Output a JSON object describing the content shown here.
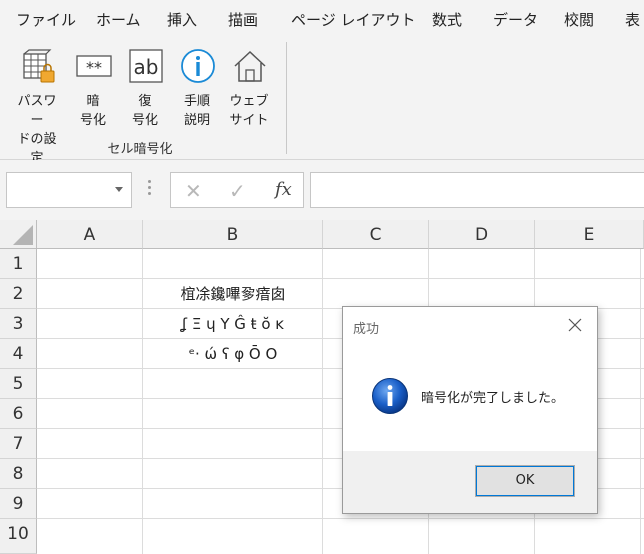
{
  "menu": {
    "tabs": [
      "ファイル",
      "ホーム",
      "挿入",
      "描画",
      "ページ レイアウト",
      "数式",
      "データ",
      "校閲",
      "表"
    ]
  },
  "ribbon": {
    "buttons": [
      {
        "label": "パスワー\nドの設定",
        "icon": "lock-grid-icon"
      },
      {
        "label": "暗\n号化",
        "icon": "asterisk-box-icon"
      },
      {
        "label": "復\n号化",
        "icon": "ab-box-icon"
      },
      {
        "label": "手順\n説明",
        "icon": "info-circle-icon"
      },
      {
        "label": "ウェブ\nサイト",
        "icon": "house-icon"
      }
    ],
    "group_label": "セル暗号化"
  },
  "formula_bar": {
    "name_box_value": "",
    "cancel_glyph": "✕",
    "enter_glyph": "✓",
    "fx_label": "fx",
    "formula_value": ""
  },
  "sheet": {
    "columns": [
      "A",
      "B",
      "C",
      "D",
      "E"
    ],
    "rows": [
      "1",
      "2",
      "3",
      "4",
      "5",
      "6",
      "7",
      "8",
      "9",
      "10"
    ],
    "cells": {
      "B2": "椬凃鑱嗶㚉瘖囱",
      "B3": "ʆ Ξ ɥ Y Ĝ ŧ ŏ ĸ",
      "B4": "ᵉ· ώ ʕ φ Ō O"
    }
  },
  "dialog": {
    "title": "成功",
    "message": "暗号化が完了しました。",
    "ok_label": "OK",
    "colors": {
      "info_blue": "#1a5fc8",
      "focus_outline": "#0078d7"
    }
  }
}
